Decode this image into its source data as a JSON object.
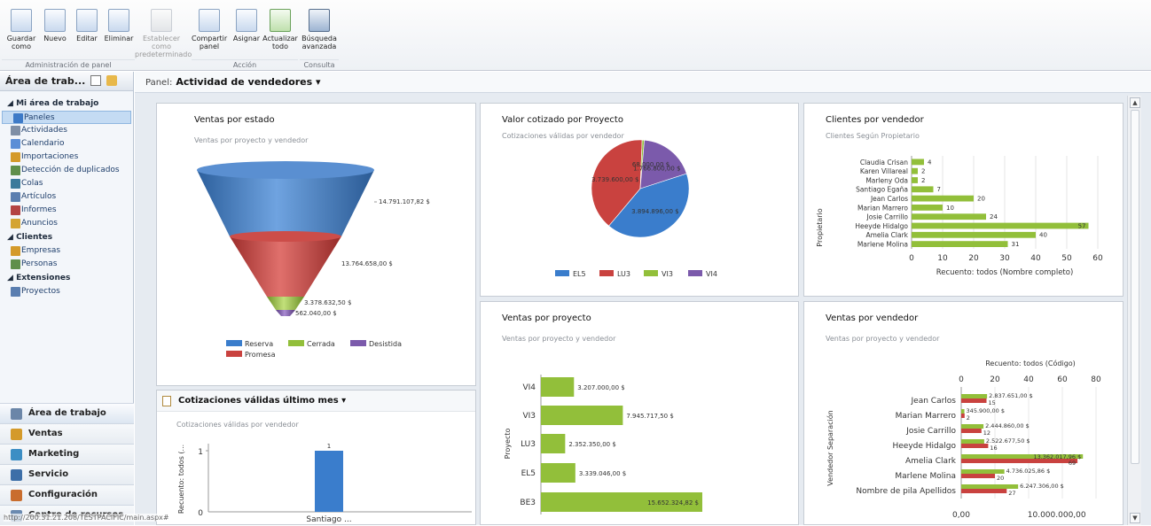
{
  "ribbon": {
    "groups": [
      {
        "label": "Administración de panel"
      },
      {
        "label": "Acción"
      },
      {
        "label": "Consulta"
      }
    ],
    "buttons": [
      {
        "label": "Guardar como",
        "icon": "save-as-icon"
      },
      {
        "label": "Nuevo",
        "icon": "new-icon"
      },
      {
        "label": "Editar",
        "icon": "edit-icon"
      },
      {
        "label": "Eliminar",
        "icon": "delete-icon"
      },
      {
        "label": "Establecer como predeterminado",
        "icon": "set-default-icon"
      },
      {
        "label": "Compartir panel",
        "icon": "share-icon"
      },
      {
        "label": "Asignar",
        "icon": "assign-icon"
      },
      {
        "label": "Actualizar todo",
        "icon": "refresh-icon"
      },
      {
        "label": "Búsqueda avanzada",
        "icon": "binoculars-icon"
      }
    ]
  },
  "nav": {
    "header": "Área de trab...",
    "sections": [
      {
        "title": "Mi área de trabajo",
        "items": [
          "Paneles",
          "Actividades",
          "Calendario",
          "Importaciones",
          "Detección de duplicados",
          "Colas",
          "Artículos",
          "Informes",
          "Anuncios"
        ]
      },
      {
        "title": "Clientes",
        "items": [
          "Empresas",
          "Personas"
        ]
      },
      {
        "title": "Extensiones",
        "items": [
          "Proyectos"
        ]
      }
    ],
    "bottom": [
      "Área de trabajo",
      "Ventas",
      "Marketing",
      "Servicio",
      "Configuración",
      "Centro de recursos"
    ]
  },
  "panel_bar": {
    "label": "Panel:",
    "name": "Actividad de vendedores ▾"
  },
  "status_url": "http://200.31.21.208/TESTPACIFIC/main.aspx#",
  "colors": {
    "blue": "#3a7dcc",
    "red": "#c9423f",
    "green": "#92bf3a",
    "purple": "#7b5aab",
    "orange": "#e9a12f"
  },
  "charts": {
    "funnel": {
      "title": "Ventas por estado",
      "subtitle": "Ventas por proyecto y vendedor",
      "labels": [
        "14.791.107,82 $",
        "13.764.658,00 $",
        "3.378.632,50 $",
        "562.040,00 $"
      ],
      "legend": [
        "Reserva",
        "Cerrada",
        "Desistida",
        "Promesa"
      ]
    },
    "pie": {
      "title": "Valor cotizado por Proyecto",
      "subtitle": "Cotizaciones válidas por vendedor",
      "labels": [
        "3.894.896,00 $",
        "3.739.600,00 $",
        "68.000,00 $",
        "1.766.800,00 $"
      ],
      "legend": [
        "EL5",
        "LU3",
        "VI3",
        "VI4"
      ]
    },
    "clientes": {
      "title": "Clientes por vendedor",
      "subtitle": "Clientes Según Propietario",
      "ylabel": "Propietario",
      "xlabel": "Recuento: todos (Nombre completo)",
      "ticks": [
        "0",
        "10",
        "20",
        "30",
        "40",
        "50",
        "60"
      ]
    },
    "cotiz": {
      "title": "Cotizaciones válidas último mes ▾",
      "subtitle": "Cotizaciones válidas por vendedor",
      "ylabel": "Recuento: todos (...",
      "value_label": "1",
      "category": "Santiago ...",
      "ticks": [
        "0",
        "1"
      ]
    },
    "proyecto": {
      "title": "Ventas por proyecto",
      "subtitle": "Ventas por proyecto y vendedor",
      "ylabel": "Proyecto"
    },
    "vendedor": {
      "title": "Ventas por vendedor",
      "subtitle": "Ventas por proyecto y vendedor",
      "ylabel": "Vendedor Separación",
      "top_axis_title": "Recuento: todos (Código)",
      "top_ticks": [
        "0",
        "20",
        "40",
        "60",
        "80"
      ],
      "bottom_ticks": [
        "0,00",
        "10.000.000,00"
      ]
    }
  },
  "chart_data": [
    {
      "type": "bar",
      "title": "Clientes por vendedor",
      "ylabel": "Propietario",
      "xlabel": "Recuento: todos (Nombre completo)",
      "xlim": [
        0,
        60
      ],
      "categories": [
        "Claudia Crisan",
        "Karen Villareal",
        "Marleny Oda",
        "Santiago Egaña",
        "Jean Carlos",
        "Marian Marrero",
        "Josie Carrillo",
        "Heeyde Hidalgo",
        "Amelia Clark",
        "Marlene Molina"
      ],
      "values": [
        4,
        2,
        2,
        7,
        20,
        10,
        24,
        57,
        40,
        31
      ]
    },
    {
      "type": "bar",
      "title": "Ventas por proyecto",
      "ylabel": "Proyecto",
      "categories": [
        "VI4",
        "VI3",
        "LU3",
        "EL5",
        "BE3"
      ],
      "values": [
        3207000,
        7945717.5,
        2352350,
        3339046,
        15652324.82
      ],
      "labels": [
        "3.207.000,00 $",
        "7.945.717,50 $",
        "2.352.350,00 $",
        "3.339.046,00 $",
        "15.652.324,82 $"
      ]
    },
    {
      "type": "bar",
      "title": "Ventas por vendedor",
      "ylabel": "Vendedor Separación",
      "categories": [
        "Jean Carlos",
        "Marian Marrero",
        "Josie Carrillo",
        "Heeyde Hidalgo",
        "Amelia Clark",
        "Marlene Molina",
        "Nombre de pila Apellidos"
      ],
      "series": [
        {
          "values": [
            2837651,
            345900,
            2444860,
            2522677.5,
            13362017.96,
            4736025.86,
            6247306
          ],
          "labels": [
            "2.837.651,00 $",
            "345.900,00 $",
            "2.444.860,00 $",
            "2.522.677,50 $",
            "13.362.017,96 $",
            "4.736.025,86 $",
            "6.247.306,00 $"
          ]
        },
        {
          "values": [
            15,
            2,
            12,
            16,
            69,
            20,
            27
          ]
        }
      ]
    },
    {
      "type": "bar",
      "title": "Cotizaciones válidas último mes",
      "categories": [
        "Santiago ..."
      ],
      "values": [
        1
      ]
    },
    {
      "type": "pie",
      "title": "Valor cotizado por Proyecto",
      "categories": [
        "EL5",
        "LU3",
        "VI3",
        "VI4"
      ],
      "values": [
        3894896,
        3739600,
        68000,
        1766800
      ]
    }
  ]
}
